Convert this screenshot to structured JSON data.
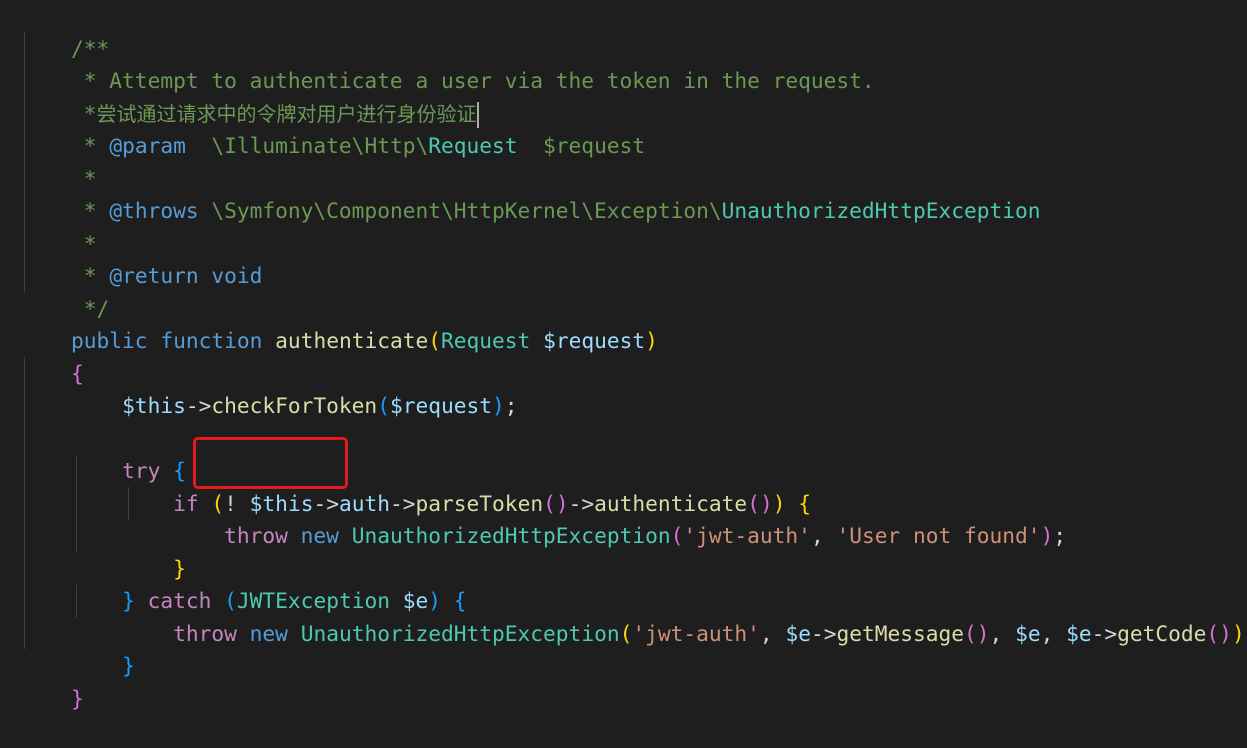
{
  "code": {
    "doc_open": "/**",
    "doc_line_1": " * Attempt to authenticate a user via the token in the request.",
    "doc_line_2_star": " *",
    "doc_line_2_cn": "尝试通过请求中的令牌对用户进行身份验证",
    "param_star": " * ",
    "param_tag": "@param",
    "param_ns": "  \\Illuminate\\Http\\",
    "param_type": "Request",
    "param_var": "  $request",
    "blank_star": " *",
    "throws_star": " * ",
    "throws_tag": "@throws",
    "throws_ns": " \\Symfony\\Component\\HttpKernel\\Exception\\",
    "throws_type": "UnauthorizedHttpException",
    "return_star": " * ",
    "return_tag": "@return",
    "return_type": " void",
    "doc_close": " */",
    "kw_public": "public",
    "kw_function": "function",
    "fn_authenticate": "authenticate",
    "type_request": "Request",
    "var_request": "$request",
    "brace_open": "{",
    "brace_close": "}",
    "var_this": "$this",
    "arrow": "->",
    "fn_check": "checkForToken",
    "kw_try": "try",
    "kw_if": "if",
    "not": "!",
    "prop_auth": "auth",
    "fn_parse": "parseToken",
    "kw_throw": "throw",
    "kw_new": "new",
    "cls_exception": "UnauthorizedHttpException",
    "str_jwt": "'jwt-auth'",
    "str_user": "'User not found'",
    "kw_catch": "catch",
    "cls_jwt": "JWTException",
    "var_e": "$e",
    "fn_getmessage": "getMessage",
    "fn_getcode": "getCode"
  },
  "colors": {
    "background": "#1e1e1e",
    "comment": "#6a9955",
    "keyword": "#569cd6",
    "control": "#c586c0",
    "function": "#dcdcaa",
    "class": "#4ec9b0",
    "variable": "#9cdcfe",
    "string": "#ce9178",
    "highlight_box": "#e51919"
  }
}
